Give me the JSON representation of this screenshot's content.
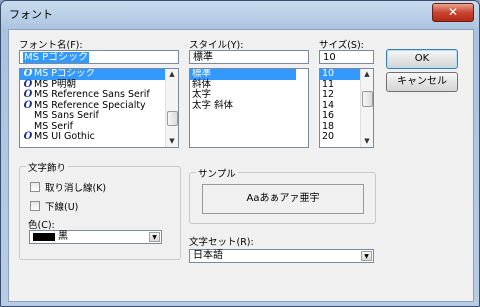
{
  "window": {
    "title": "フォント",
    "close": "✕"
  },
  "font": {
    "label": "フォント名(F):",
    "value": "MS Pゴシック",
    "items": [
      {
        "name": "MS Pゴシック",
        "selected": true
      },
      {
        "name": "MS P明朝"
      },
      {
        "name": "MS Reference Sans Serif"
      },
      {
        "name": "MS Reference Specialty"
      },
      {
        "name": "MS Sans Serif"
      },
      {
        "name": "MS Serif"
      },
      {
        "name": "MS UI Gothic"
      }
    ]
  },
  "style": {
    "label": "スタイル(Y):",
    "value": "標準",
    "items": [
      "標準",
      "斜体",
      "太字",
      "太字 斜体"
    ]
  },
  "size": {
    "label": "サイズ(S):",
    "value": "10",
    "items": [
      "10",
      "11",
      "12",
      "14",
      "16",
      "18",
      "20"
    ]
  },
  "buttons": {
    "ok": "OK",
    "cancel": "キャンセル"
  },
  "effects": {
    "title": "文字飾り",
    "strikeout": "取り消し線(K)",
    "underline": "下線(U)",
    "color_label": "色(C):",
    "color_value": "黒",
    "color_hex": "#000000"
  },
  "sample": {
    "title": "サンプル",
    "text": "Aaあぁアァ亜宇"
  },
  "script": {
    "label": "文字セット(R):",
    "value": "日本語"
  }
}
